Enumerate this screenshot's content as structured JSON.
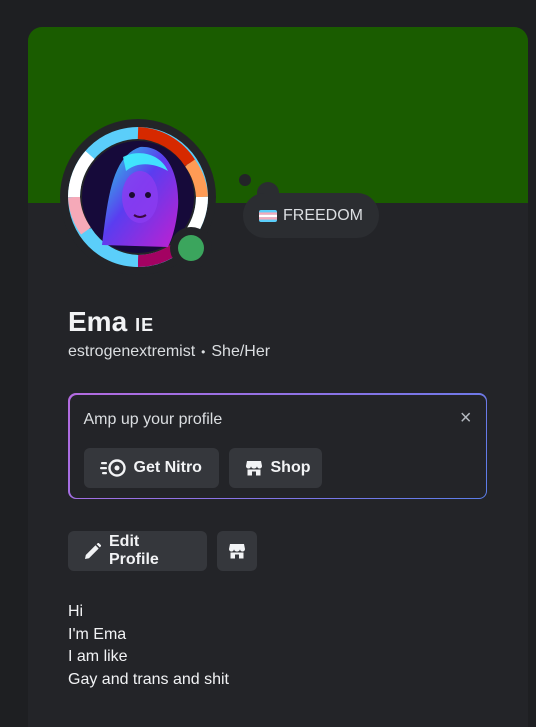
{
  "profile": {
    "display_name": "Ema",
    "guild_tag": "IE",
    "username": "estrogenextremist",
    "separator": "•",
    "pronouns": "She/Her",
    "status_text": "FREEDOM",
    "online_status": "online",
    "banner_color": "#1a5c00",
    "status_color": "#3ba55d"
  },
  "promo": {
    "title": "Amp up your profile",
    "close_icon": "×",
    "nitro_label": "Get Nitro",
    "shop_label": "Shop"
  },
  "actions": {
    "edit_profile_label": "Edit Profile"
  },
  "bio": {
    "lines": [
      "Hi",
      "I'm Ema",
      "I am like",
      "Gay and trans and shit"
    ]
  },
  "icons": {
    "nitro": "nitro-icon",
    "shop": "shop-icon",
    "edit": "pencil-icon",
    "flag": "trans-flag-icon",
    "close": "close-icon"
  }
}
